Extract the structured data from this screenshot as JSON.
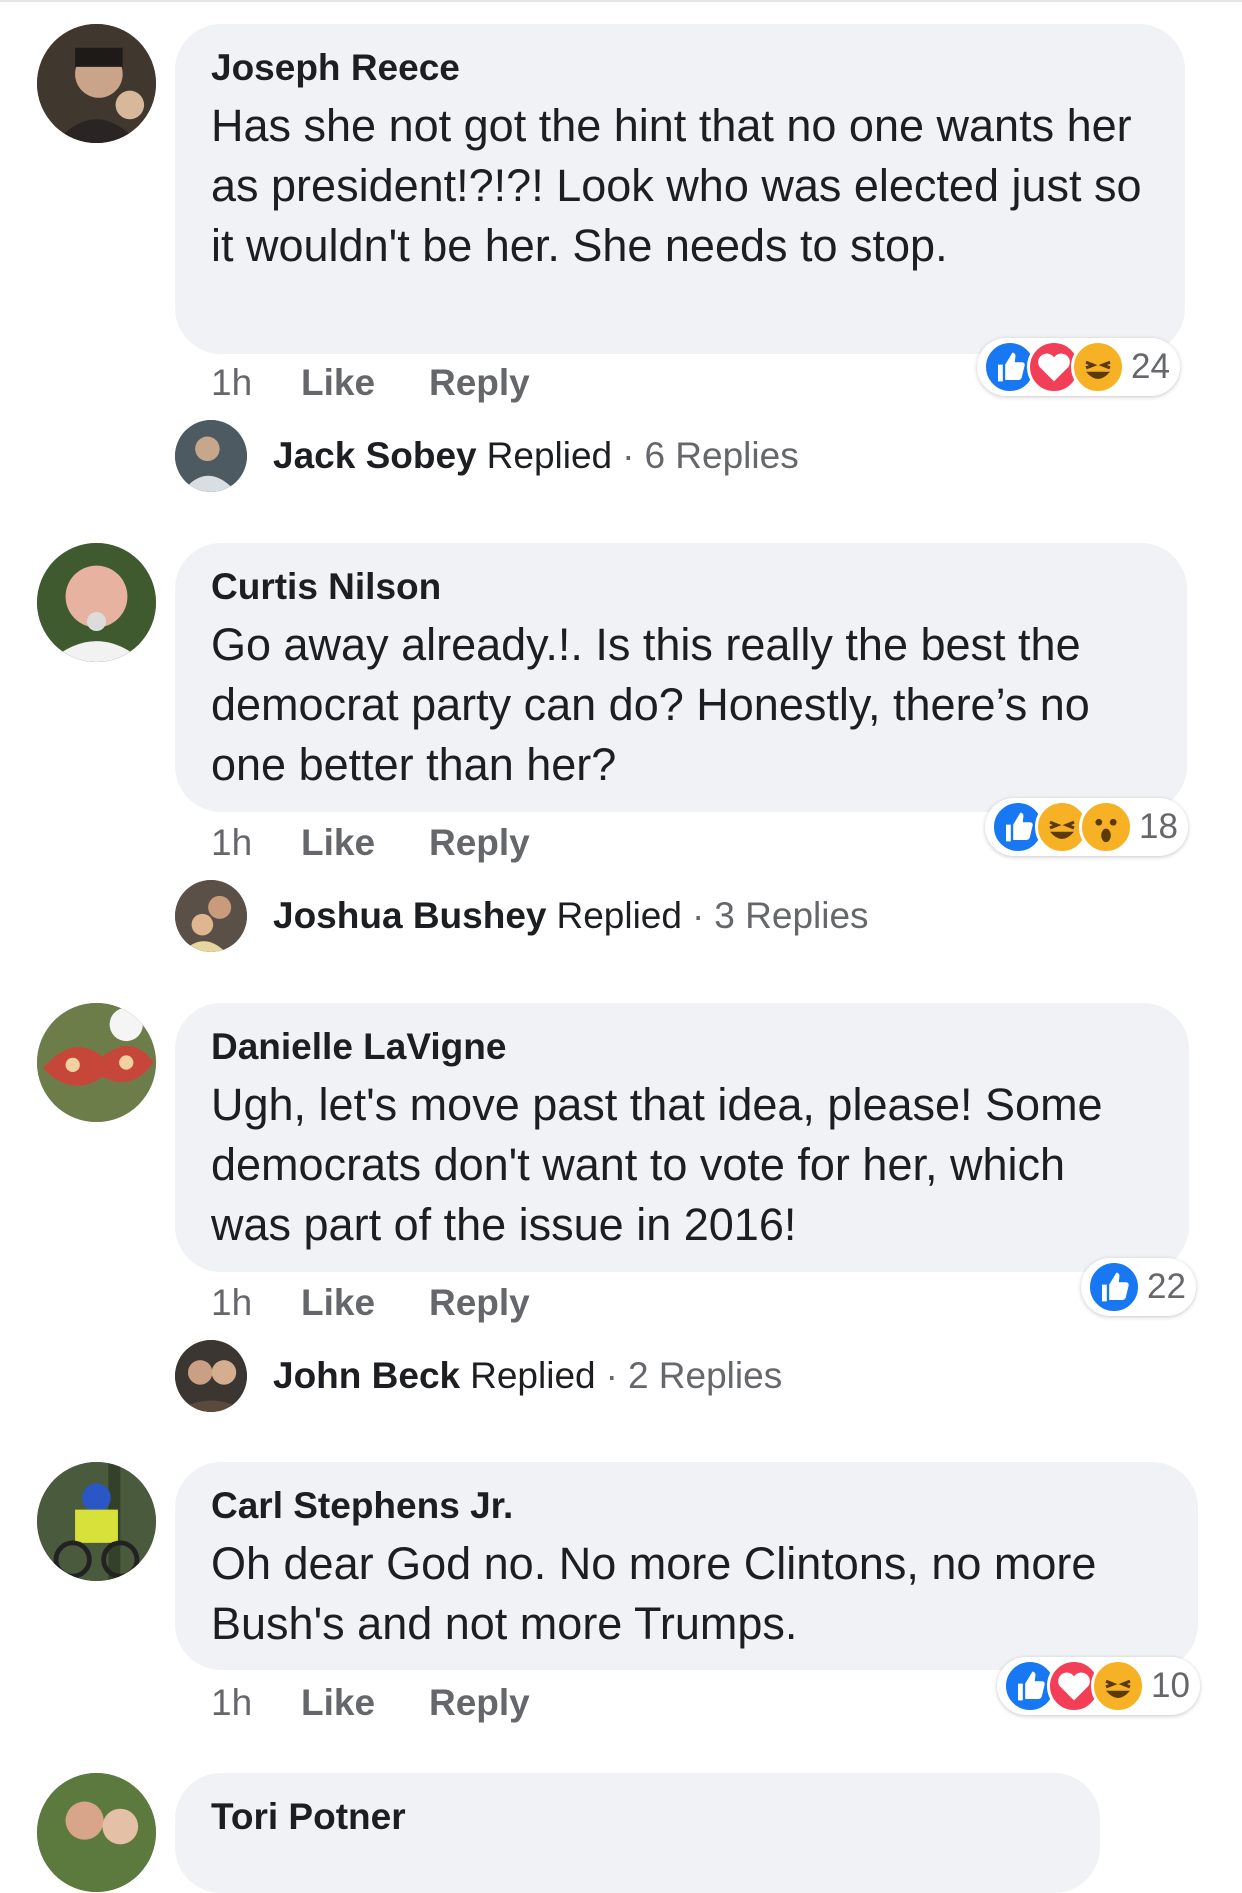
{
  "comments": [
    {
      "author": "Joseph Reece",
      "text": "Has she not got the hint that no one wants her as president!?!?! Look who was elected just so it wouldn't be her. She needs to stop.",
      "time": "1h",
      "like": "Like",
      "reply": "Reply",
      "reactions": [
        "like-icon",
        "love-icon",
        "haha-icon"
      ],
      "reaction_count": "24",
      "replied": {
        "name": "Jack Sobey",
        "word": "Replied",
        "dot": "·",
        "count": "6 Replies"
      }
    },
    {
      "author": "Curtis Nilson",
      "text": "Go away already.!. Is this really the best the democrat party can do? Honestly, there’s no one better than her?",
      "time": "1h",
      "like": "Like",
      "reply": "Reply",
      "reactions": [
        "like-icon",
        "haha-icon",
        "wow-icon"
      ],
      "reaction_count": "18",
      "replied": {
        "name": "Joshua Bushey",
        "word": "Replied",
        "dot": "·",
        "count": "3 Replies"
      }
    },
    {
      "author": "Danielle LaVigne",
      "text": "Ugh,  let's move past that idea,  please! Some democrats don't want to vote for her, which was part of the issue in 2016!",
      "time": "1h",
      "like": "Like",
      "reply": "Reply",
      "reactions": [
        "like-icon"
      ],
      "reaction_count": "22",
      "replied": {
        "name": "John Beck",
        "word": "Replied",
        "dot": "·",
        "count": "2 Replies"
      }
    },
    {
      "author": "Carl Stephens Jr.",
      "text": "Oh dear God no. No more Clintons, no more Bush's and not more Trumps.",
      "time": "1h",
      "like": "Like",
      "reply": "Reply",
      "reactions": [
        "like-icon",
        "love-icon",
        "haha-icon"
      ],
      "reaction_count": "10"
    },
    {
      "author": "Tori Potner"
    }
  ],
  "colors": {
    "like": "#1877f2",
    "love": "#f33e58",
    "haha": "#f7b125",
    "bubble": "#f0f2f5",
    "meta": "#65676b"
  }
}
